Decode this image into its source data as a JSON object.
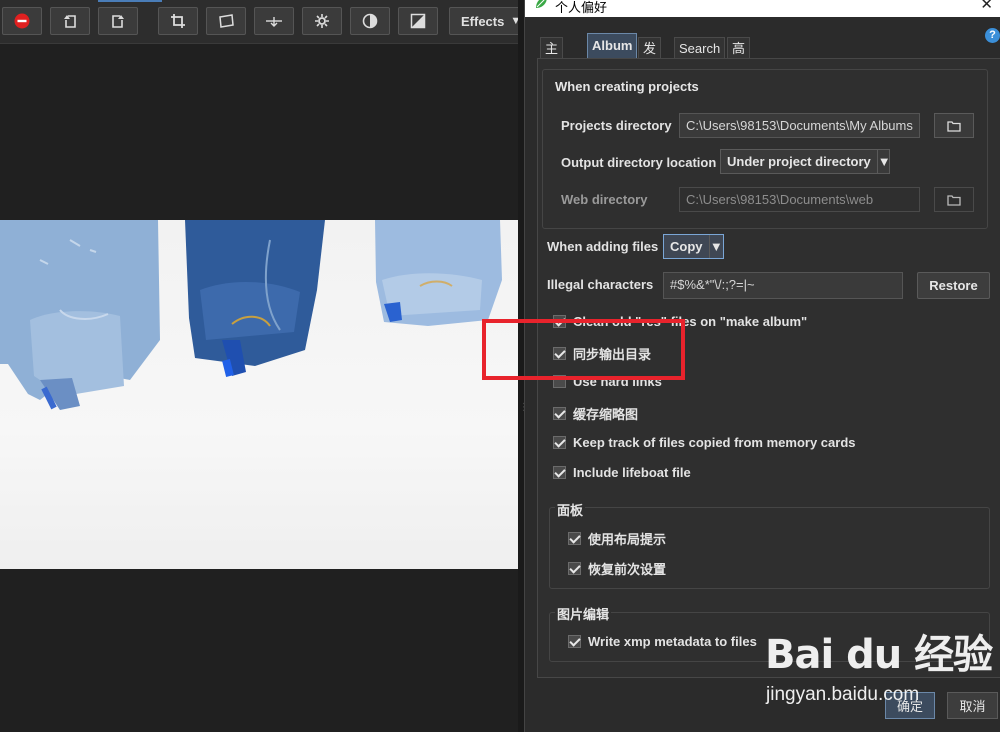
{
  "toolbar": {
    "effects_label": "Effects",
    "icons": [
      "stop-icon",
      "rotate-left-icon",
      "rotate-right-icon",
      "crop-icon",
      "straighten-icon",
      "level-icon",
      "settings-icon",
      "contrast-icon",
      "exposure-icon"
    ]
  },
  "dialog": {
    "title": "个人偏好",
    "help": "?",
    "tabs": [
      {
        "label": "主面板",
        "active": false
      },
      {
        "label": "Album",
        "active": true
      },
      {
        "label": "发布",
        "active": false
      },
      {
        "label": "Search",
        "active": false
      },
      {
        "label": "高级",
        "active": false
      }
    ],
    "creating": {
      "title": "When creating projects",
      "projects_dir_label": "Projects directory",
      "projects_dir_value": "C:\\Users\\98153\\Documents\\My Albums",
      "output_loc_label": "Output directory location",
      "output_loc_value": "Under project directory",
      "web_dir_label": "Web directory",
      "web_dir_value": "C:\\Users\\98153\\Documents\\web"
    },
    "adding_files_label": "When adding files",
    "adding_files_value": "Copy",
    "illegal_label": "Illegal characters",
    "illegal_value": "#$%&*\"\\/:;?=|~",
    "restore_label": "Restore",
    "checkboxes": [
      {
        "label": "Clean old \"res\" files on \"make album\"",
        "checked": true
      },
      {
        "label": "同步输出目录",
        "checked": true
      },
      {
        "label": "Use hard links",
        "checked": false
      },
      {
        "label": "缓存缩略图",
        "checked": true
      },
      {
        "label": "Keep track of files copied from memory cards",
        "checked": true
      },
      {
        "label": "Include lifeboat file",
        "checked": true
      }
    ],
    "panel_group": {
      "title": "面板",
      "items": [
        {
          "label": "使用布局提示",
          "checked": true
        },
        {
          "label": "恢复前次设置",
          "checked": true
        }
      ]
    },
    "image_edit_group": {
      "title": "图片编辑",
      "items": [
        {
          "label": "Write xmp metadata to files",
          "checked": true
        }
      ]
    },
    "ok_label": "确定",
    "cancel_label": "取消"
  },
  "watermark": {
    "logo": "Bai du 经验",
    "url": "jingyan.baidu.com"
  },
  "colors": {
    "highlight": "#e8232c",
    "accent": "#6b88a8"
  }
}
